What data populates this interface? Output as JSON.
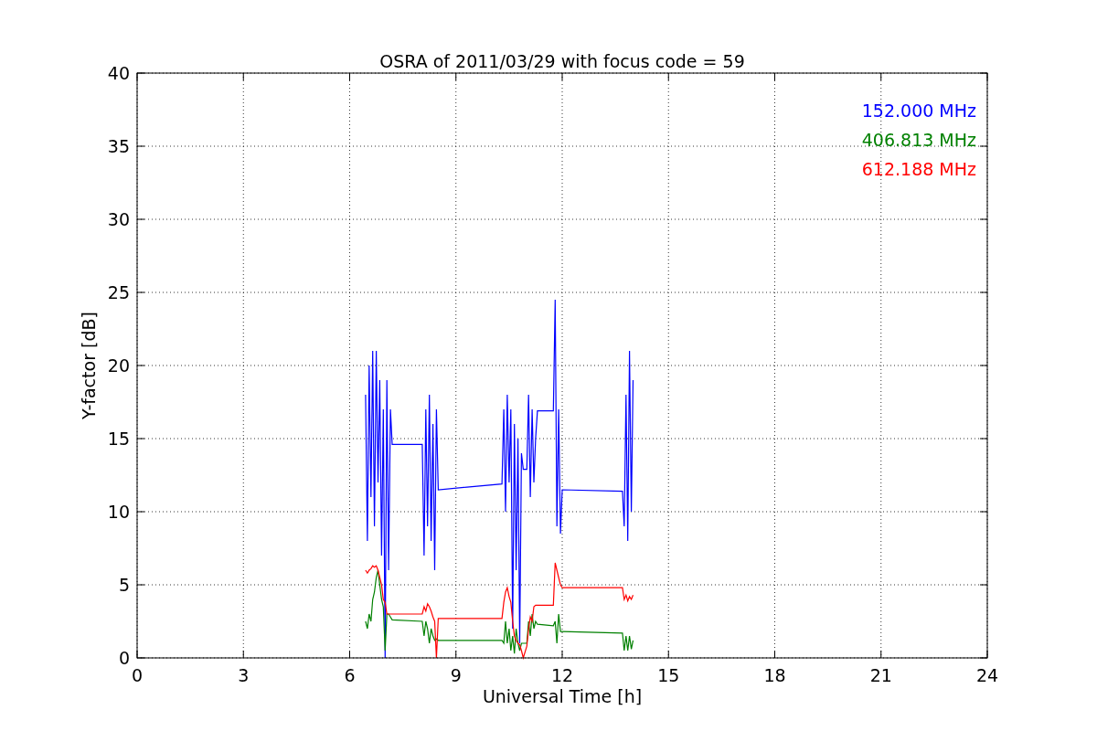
{
  "figure": {
    "chart_data": {
      "type": "line",
      "title": "OSRA of 2011/03/29 with focus code = 59",
      "xlabel": "Universal Time [h]",
      "ylabel": "Y-factor [dB]",
      "x": [
        6.45,
        6.5,
        6.55,
        6.6,
        6.65,
        6.7,
        6.75,
        6.8,
        6.85,
        6.9,
        6.95,
        7.0,
        7.05,
        7.1,
        7.15,
        7.2,
        8.05,
        8.1,
        8.15,
        8.2,
        8.25,
        8.3,
        8.35,
        8.4,
        8.45,
        8.5,
        10.3,
        10.35,
        10.4,
        10.45,
        10.5,
        10.55,
        10.6,
        10.65,
        10.7,
        10.75,
        10.8,
        10.85,
        10.9,
        11.0,
        11.05,
        11.1,
        11.15,
        11.2,
        11.25,
        11.3,
        11.75,
        11.8,
        11.85,
        11.9,
        11.95,
        12.0,
        13.7,
        13.75,
        13.8,
        13.85,
        13.9,
        13.95,
        14.0
      ],
      "series": [
        {
          "name": "152.000 MHz",
          "color": "#0000ff",
          "values": [
            18,
            8,
            20,
            11,
            21,
            9,
            21,
            12,
            19,
            7,
            17,
            0,
            19,
            6,
            17,
            14.6,
            14.6,
            7,
            17,
            9,
            18,
            8,
            16,
            6,
            17,
            11.5,
            11.9,
            17,
            10,
            18,
            12,
            17,
            2,
            16,
            6,
            15,
            1,
            14,
            12.9,
            12.9,
            18,
            11,
            17,
            12,
            15,
            16.9,
            16.9,
            24.5,
            9,
            17,
            8.5,
            11.5,
            11.4,
            9,
            18,
            8,
            21,
            10,
            19
          ]
        },
        {
          "name": "406.813 MHz",
          "color": "#008000",
          "values": [
            2.5,
            2,
            3,
            2.5,
            4,
            4.5,
            5.5,
            6,
            5,
            4,
            3.5,
            0.5,
            3,
            3,
            2.8,
            2.6,
            2.5,
            1.5,
            2.5,
            2,
            1,
            2,
            1.5,
            1.2,
            1.3,
            1.2,
            1.2,
            1,
            2.5,
            1,
            2,
            0.5,
            1.5,
            0.3,
            2,
            1,
            0.5,
            1,
            1,
            1,
            2.5,
            1.5,
            3,
            2,
            2.5,
            2.3,
            2.2,
            2.5,
            1,
            3,
            1.8,
            1.8,
            1.7,
            0.5,
            1.5,
            0.5,
            1.5,
            0.6,
            1.2
          ]
        },
        {
          "name": "612.188 MHz",
          "color": "#ff0000",
          "values": [
            6,
            5.8,
            6,
            6.1,
            6.3,
            6.2,
            6.3,
            6,
            5.5,
            5,
            4,
            3.8,
            3,
            3,
            3,
            3,
            3,
            3.5,
            3.2,
            3.7,
            3.5,
            3.2,
            2.8,
            2.5,
            0,
            2.7,
            2.7,
            3.8,
            4.5,
            4.8,
            4.2,
            3.8,
            2.5,
            1.5,
            1.2,
            1,
            0.9,
            0.5,
            0,
            0.8,
            2,
            2.8,
            2.5,
            3.5,
            3.6,
            3.6,
            3.6,
            6.5,
            6,
            5.5,
            5,
            4.8,
            4.8,
            4,
            4.3,
            3.9,
            4.2,
            4,
            4.3
          ]
        }
      ],
      "grid": true,
      "xlim": [
        0,
        24
      ],
      "ylim": [
        0,
        40
      ],
      "xticks": [
        0,
        3,
        6,
        9,
        12,
        15,
        18,
        21,
        24
      ],
      "yticks": [
        0,
        5,
        10,
        15,
        20,
        25,
        30,
        35,
        40
      ]
    }
  }
}
